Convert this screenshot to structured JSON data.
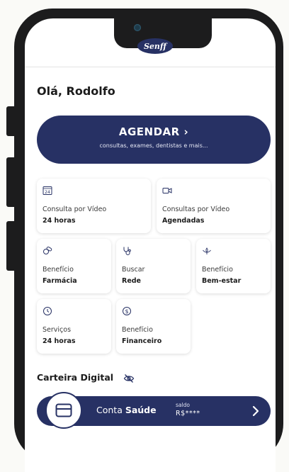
{
  "app": {
    "logo_text": "Senff",
    "greeting": "Olá, Rodolfo"
  },
  "cta": {
    "title": "AGENDAR",
    "arrow": "›",
    "subtitle": "consultas, exames, dentistas e mais..."
  },
  "cards": [
    {
      "icon": "calendar-24-icon",
      "line1": "Consulta por Vídeo",
      "line2": "24 horas"
    },
    {
      "icon": "video-camera-icon",
      "line1": "Consultas por Vídeo",
      "line2": "Agendadas"
    },
    {
      "icon": "pills-icon",
      "line1": "Benefício",
      "line2": "Farmácia"
    },
    {
      "icon": "stethoscope-icon",
      "line1": "Buscar",
      "line2": "Rede"
    },
    {
      "icon": "lotus-icon",
      "line1": "Benefício",
      "line2": "Bem-estar"
    },
    {
      "icon": "clock-icon",
      "line1": "Serviços",
      "line2": "24 horas"
    },
    {
      "icon": "dollar-coin-icon",
      "line1": "Benefício",
      "line2": "Financeiro"
    }
  ],
  "wallet": {
    "section_title": "Carteira Digital",
    "account_prefix": "Conta ",
    "account_name": "Saúde",
    "balance_label": "saldo",
    "balance_value": "R$****"
  },
  "colors": {
    "brand_navy": "#273164",
    "phone_frame": "#1c1c1d",
    "background": "#fafaf7"
  }
}
